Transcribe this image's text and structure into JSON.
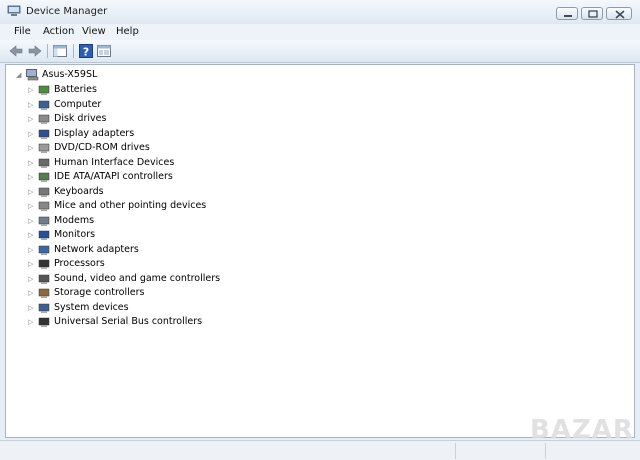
{
  "window": {
    "title": "Device Manager"
  },
  "menu": [
    "File",
    "Action",
    "View",
    "Help"
  ],
  "tree": {
    "root": "Asus-X59SL",
    "items": [
      {
        "label": "Batteries",
        "icon": "battery-icon"
      },
      {
        "label": "Computer",
        "icon": "computer-icon"
      },
      {
        "label": "Disk drives",
        "icon": "disk-drive-icon"
      },
      {
        "label": "Display adapters",
        "icon": "display-adapter-icon"
      },
      {
        "label": "DVD/CD-ROM drives",
        "icon": "dvd-drive-icon"
      },
      {
        "label": "Human Interface Devices",
        "icon": "hid-icon"
      },
      {
        "label": "IDE ATA/ATAPI controllers",
        "icon": "ide-controller-icon"
      },
      {
        "label": "Keyboards",
        "icon": "keyboard-icon"
      },
      {
        "label": "Mice and other pointing devices",
        "icon": "mouse-icon"
      },
      {
        "label": "Modems",
        "icon": "modem-icon"
      },
      {
        "label": "Monitors",
        "icon": "monitor-icon"
      },
      {
        "label": "Network adapters",
        "icon": "network-adapter-icon"
      },
      {
        "label": "Processors",
        "icon": "processor-icon"
      },
      {
        "label": "Sound, video and game controllers",
        "icon": "sound-icon"
      },
      {
        "label": "Storage controllers",
        "icon": "storage-controller-icon"
      },
      {
        "label": "System devices",
        "icon": "system-devices-icon"
      },
      {
        "label": "Universal Serial Bus controllers",
        "icon": "usb-icon"
      }
    ]
  },
  "watermark": "BAZAR"
}
